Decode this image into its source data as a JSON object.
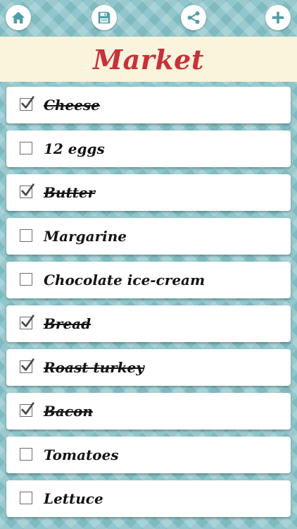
{
  "toolbar": {
    "buttons": [
      {
        "icon": "home-icon"
      },
      {
        "icon": "save-icon"
      },
      {
        "icon": "share-icon"
      },
      {
        "icon": "plus-icon"
      }
    ]
  },
  "header": {
    "title": "Market"
  },
  "list": {
    "items": [
      {
        "label": "Cheese",
        "checked": true
      },
      {
        "label": "12 eggs",
        "checked": false
      },
      {
        "label": "Butter",
        "checked": true
      },
      {
        "label": "Margarine",
        "checked": false
      },
      {
        "label": "Chocolate ice-cream",
        "checked": false
      },
      {
        "label": "Bread",
        "checked": true
      },
      {
        "label": "Roast turkey",
        "checked": true
      },
      {
        "label": "Bacon",
        "checked": true
      },
      {
        "label": "Tomatoes",
        "checked": false
      },
      {
        "label": "Lettuce",
        "checked": false
      }
    ]
  },
  "colors": {
    "title": "#c8313a",
    "icon": "#4f9ea6",
    "header_background": "#fbf4dc",
    "background": "#8fc7cc"
  }
}
